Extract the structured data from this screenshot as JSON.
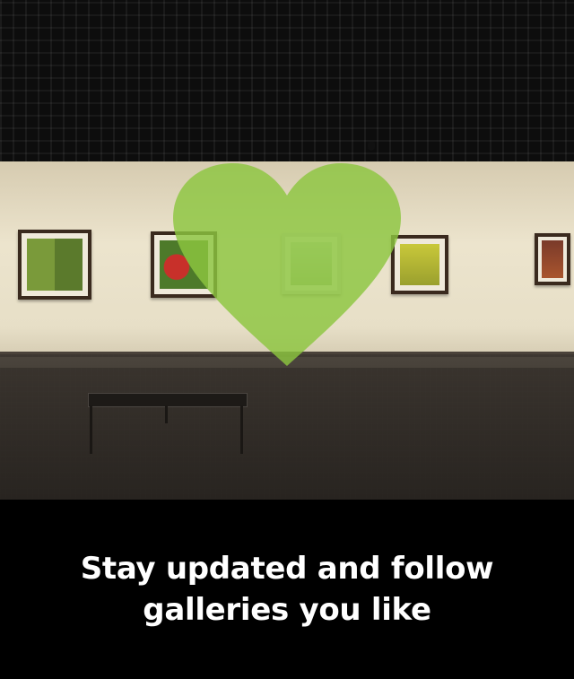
{
  "onboarding": {
    "caption": "Stay updated and follow galleries you like",
    "heart_icon": "heart-icon",
    "heart_color": "#8cc63f",
    "background_color": "#000000",
    "caption_color": "#ffffff"
  }
}
